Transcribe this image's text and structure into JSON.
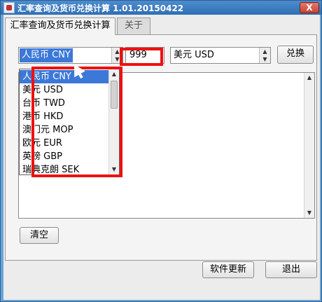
{
  "window": {
    "title": "汇率查询及货币兑换计算 1.01.20150422",
    "close_label": "X"
  },
  "tabs": [
    {
      "label": "汇率查询及货币兑换计算"
    },
    {
      "label": "关于"
    }
  ],
  "converter": {
    "from_currency": "人民币 CNY",
    "amount": "999",
    "to_currency": "美元 USD",
    "convert_label": "兑换"
  },
  "dropdown": {
    "options": [
      "人民币 CNY",
      "美元 USD",
      "台币 TWD",
      "港币 HKD",
      "澳门元 MOP",
      "欧元 EUR",
      "英镑 GBP",
      "瑞典克朗 SEK"
    ],
    "selected_index": 0
  },
  "buttons": {
    "clear": "清空",
    "update": "软件更新",
    "exit": "退出"
  },
  "colors": {
    "selection": "#3b78d8",
    "highlight_box": "#ee1111",
    "titlebar": "#2f6fb4"
  }
}
